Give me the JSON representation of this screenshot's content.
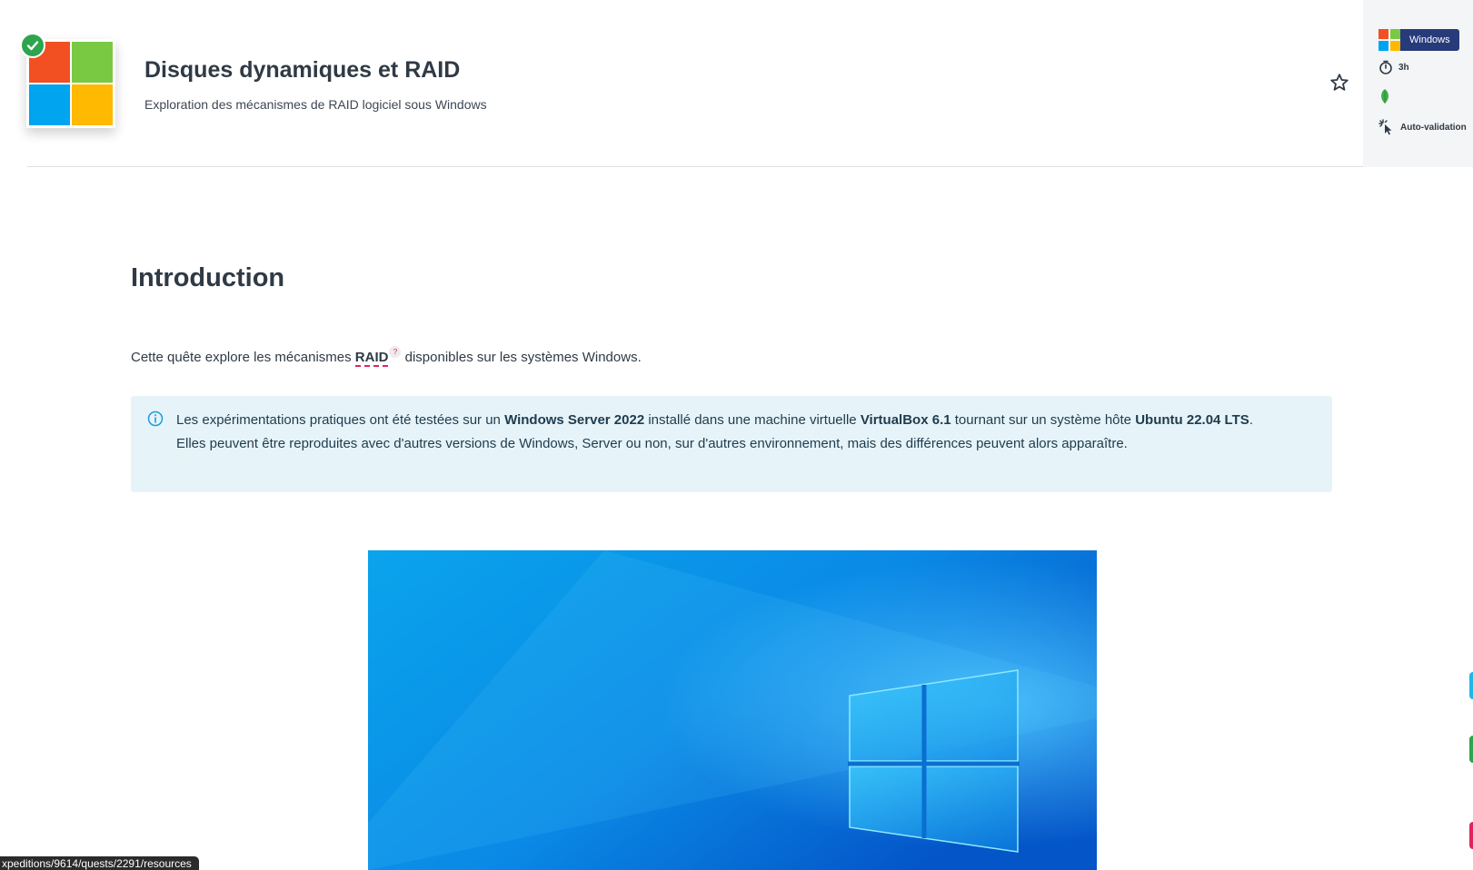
{
  "header": {
    "title": "Disques dynamiques et RAID",
    "subtitle": "Exploration des mécanismes de RAID logiciel sous Windows",
    "logo_icon": "windows-logo-icon",
    "completed_icon": "check-circle-icon",
    "favorite_icon": "star-outline-icon"
  },
  "meta": {
    "os_label": "Windows",
    "duration": "3h",
    "difficulty_icon": "leaf-icon",
    "validation_label": "Auto-validation"
  },
  "content": {
    "heading": "Introduction",
    "intro_prefix": "Cette quête explore les mécanismes ",
    "intro_term": "RAID",
    "intro_term_mark": "?",
    "intro_suffix": " disponibles sur les systèmes Windows.",
    "info": {
      "t1": "Les expérimentations pratiques ont été testées sur un ",
      "b1": "Windows Server 2022",
      "t2": " installé dans une machine virtuelle ",
      "b2": "VirtualBox 6.1",
      "t3": " tournant sur un système hôte ",
      "b3": "Ubuntu 22.04 LTS",
      "t4": ".",
      "line2": "Elles peuvent être reproduites avec d'autres versions de Windows, Server ou non, sur d'autres environnement, mais des différences peuvent alors apparaître."
    }
  },
  "status_bar": {
    "url": "xpeditions/9614/quests/2291/resources"
  },
  "colors": {
    "accent": "#273a7a",
    "info_bg": "#e6f4fa",
    "success": "#2ea44f",
    "term_underline": "#e0245e"
  }
}
